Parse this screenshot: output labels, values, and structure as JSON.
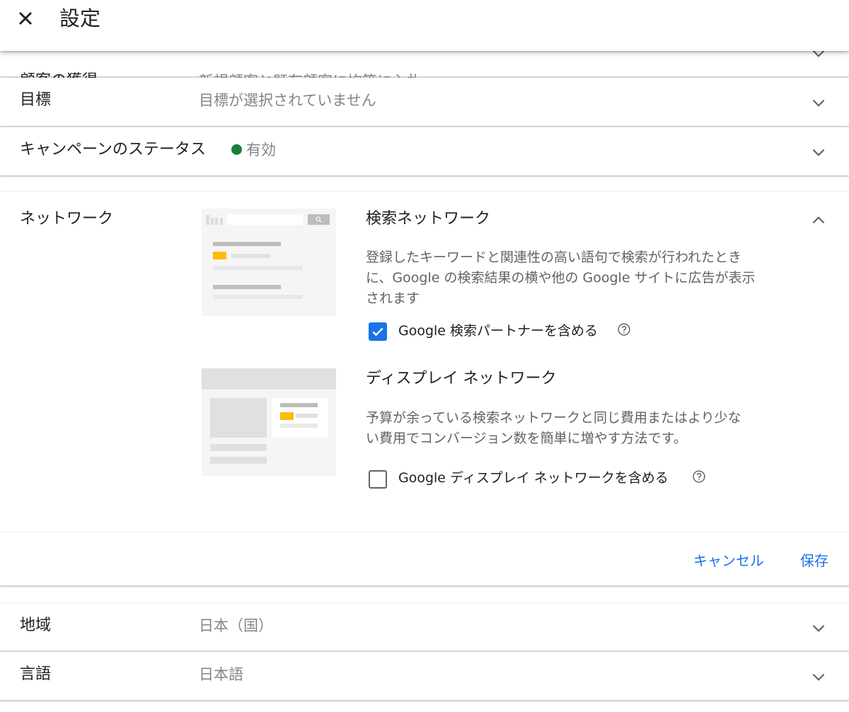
{
  "header": {
    "title": "設定"
  },
  "rows": {
    "customer_acquisition": {
      "label": "顧客の獲得",
      "value": "新規顧客と既存顧客に均等に入札"
    },
    "goal": {
      "label": "目標",
      "value": "目標が選択されていません"
    },
    "campaign_status": {
      "label": "キャンペーンのステータス",
      "value": "有効",
      "status_color": "#188038"
    },
    "location": {
      "label": "地域",
      "value": "日本（国）"
    },
    "language": {
      "label": "言語",
      "value": "日本語"
    }
  },
  "network": {
    "label": "ネットワーク",
    "search": {
      "title": "検索ネットワーク",
      "description_lines": [
        "登録したキーワードと関連性の高い語句で検索が行われたとき",
        "に、Google の検索結果の横や他の Google サイトに広告が表示",
        "されます"
      ],
      "checkbox_label": "Google 検索パートナーを含める",
      "checked": true
    },
    "display": {
      "title": "ディスプレイ ネットワーク",
      "description_lines": [
        "予算が余っている検索ネットワークと同じ費用またはより少な",
        "い費用でコンバージョン数を簡単に増やす方法です。"
      ],
      "checkbox_label": "Google ディスプレイ ネットワークを含める",
      "checked": false
    },
    "cancel_label": "キャンセル",
    "save_label": "保存"
  },
  "colors": {
    "accent": "#1a73e8",
    "ad_highlight": "#fbbc04"
  },
  "icons": {
    "close": "close-icon",
    "expand": "chevron-down-icon",
    "collapse": "chevron-up-icon",
    "help": "help-circle-icon",
    "check": "check-icon"
  }
}
